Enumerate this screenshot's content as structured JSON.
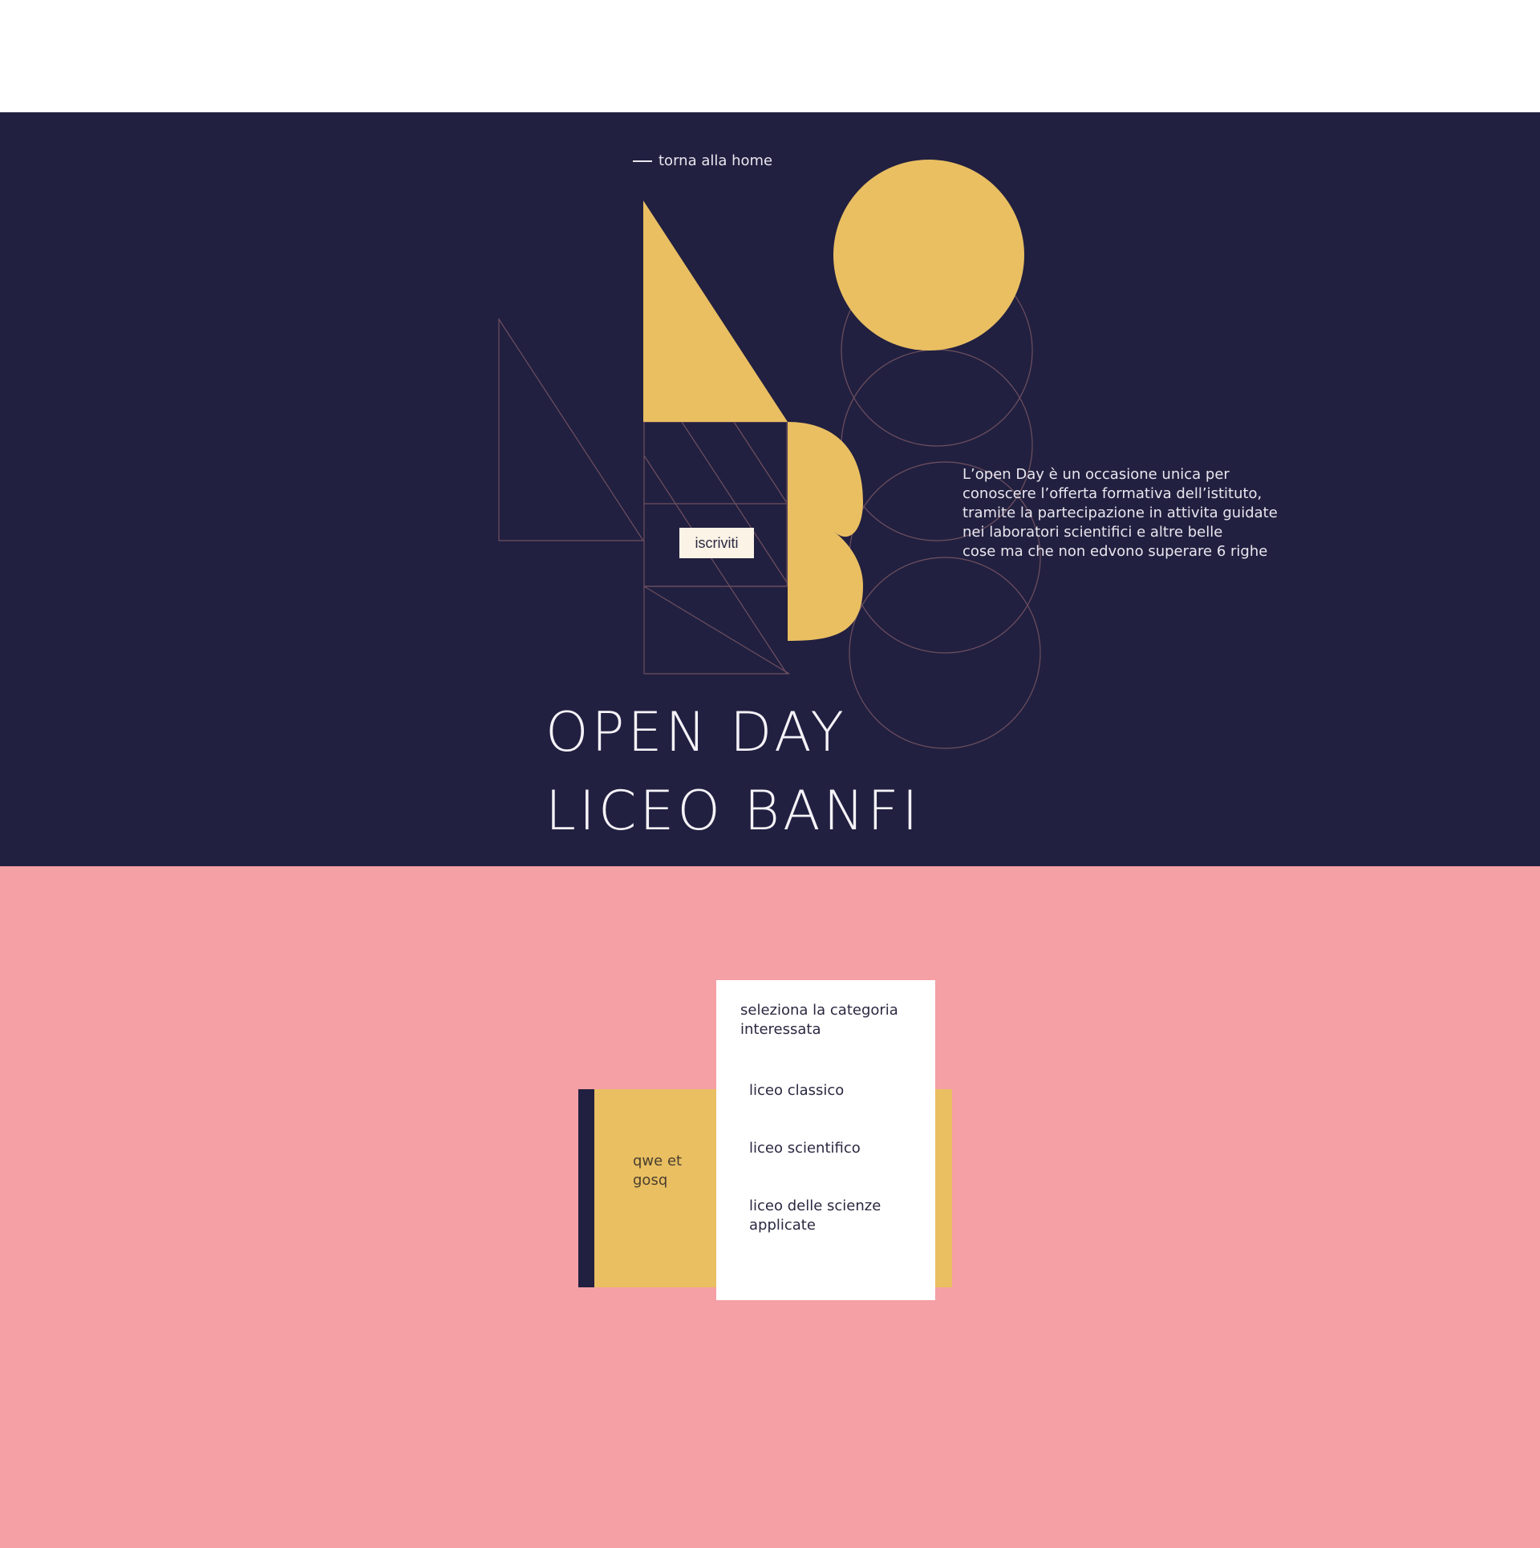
{
  "hero": {
    "back_link": "torna alla home",
    "signup_button": "iscriviti",
    "description": "L’open Day è un occasione unica per\nconoscere l’offerta formativa dell’istituto,\ntramite la partecipazione in attivita guidate\nnei laboratori scientifici e altre belle\n cose ma che non edvono superare 6 righe",
    "title_line1": "OPEN DAY",
    "title_line2": "LICEO BANFI"
  },
  "card": {
    "label": "qwe et\ngosq"
  },
  "dropdown": {
    "title": "seleziona la categoria interessata",
    "options": [
      "liceo classico",
      "liceo scientifico",
      "liceo delle scienze applicate"
    ]
  },
  "colors": {
    "navy": "#222040",
    "yellow": "#e9bf62",
    "pink": "#f4a0a5",
    "line": "#6e5060",
    "cream": "#faf3e6"
  }
}
